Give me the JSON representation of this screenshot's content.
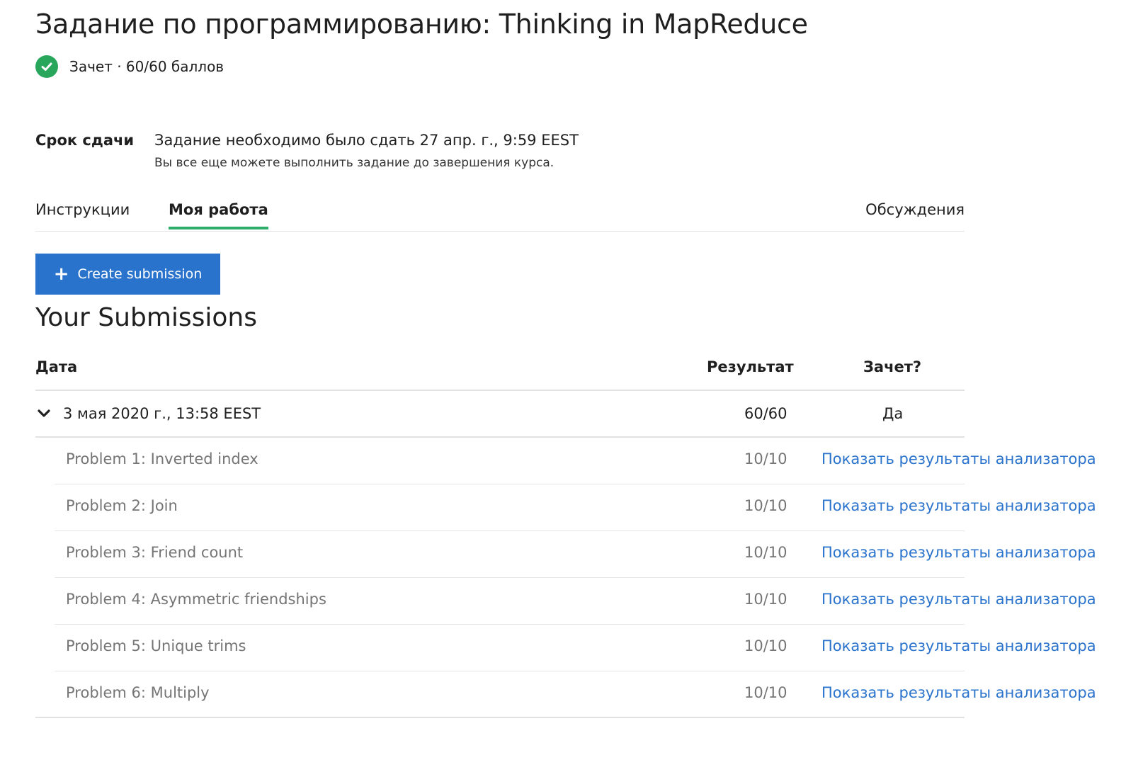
{
  "page": {
    "title": "Задание по программированию: Thinking in MapReduce",
    "status": "Зачет · 60/60 баллов"
  },
  "deadline": {
    "label": "Срок сдачи",
    "text": "Задание необходимо было сдать 27 апр. г., 9:59 EEST",
    "note": "Вы все еще можете выполнить задание до завершения курса."
  },
  "tabs": [
    {
      "label": "Инструкции",
      "active": false
    },
    {
      "label": "Моя работа",
      "active": true
    },
    {
      "label": "Обсуждения",
      "active": false
    }
  ],
  "actions": {
    "create_label": "Create submission"
  },
  "submissions": {
    "title": "Your Submissions",
    "columns": {
      "date": "Дата",
      "result": "Результат",
      "pass": "Зачет?"
    },
    "rows": [
      {
        "date": "3 мая 2020 г., 13:58 EEST",
        "score": "60/60",
        "passed": "Да",
        "problems": [
          {
            "name": "Problem 1: Inverted index",
            "score": "10/10",
            "link": "Показать результаты анализатора"
          },
          {
            "name": "Problem 2: Join",
            "score": "10/10",
            "link": "Показать результаты анализатора"
          },
          {
            "name": "Problem 3: Friend count",
            "score": "10/10",
            "link": "Показать результаты анализатора"
          },
          {
            "name": "Problem 4: Asymmetric friendships",
            "score": "10/10",
            "link": "Показать результаты анализатора"
          },
          {
            "name": "Problem 5: Unique trims",
            "score": "10/10",
            "link": "Показать результаты анализатора"
          },
          {
            "name": "Problem 6: Multiply",
            "score": "10/10",
            "link": "Показать результаты анализатора"
          }
        ]
      }
    ]
  },
  "icons": {
    "status": "check-circle-icon",
    "expand": "chevron-down-icon",
    "create": "plus-icon"
  },
  "colors": {
    "success": "#28a65b",
    "tab_underline": "#2eae6a",
    "primary": "#2a73cc",
    "muted_text": "#757575"
  }
}
